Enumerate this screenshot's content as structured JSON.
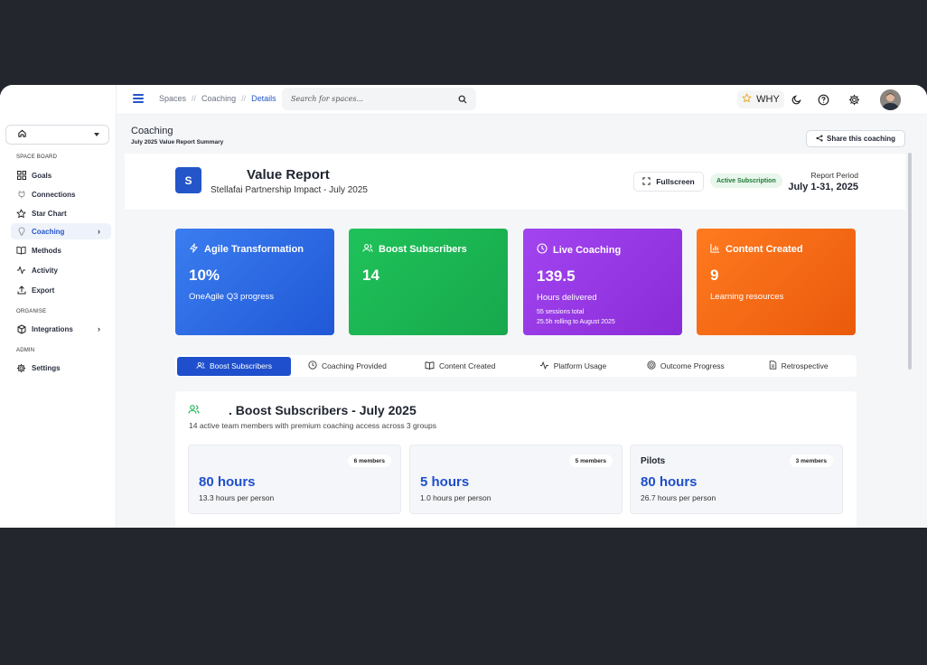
{
  "sidebar": {
    "sections": {
      "space_board": "SPACE BOARD",
      "organise": "ORGANISE",
      "admin": "ADMIN"
    },
    "items": [
      {
        "label": "Goals",
        "icon": "grid-icon"
      },
      {
        "label": "Connections",
        "icon": "plug-icon"
      },
      {
        "label": "Star Chart",
        "icon": "star-icon"
      },
      {
        "label": "Coaching",
        "icon": "lightbulb-icon"
      },
      {
        "label": "Methods",
        "icon": "book-icon"
      },
      {
        "label": "Activity",
        "icon": "activity-icon"
      },
      {
        "label": "Export",
        "icon": "upload-icon"
      },
      {
        "label": "Integrations",
        "icon": "box-icon"
      },
      {
        "label": "Settings",
        "icon": "gear-icon"
      }
    ]
  },
  "topbar": {
    "breadcrumbs": [
      "Spaces",
      "Coaching",
      "Details"
    ],
    "breadcrumb_sep": "//",
    "search_placeholder": "Search for spaces...",
    "why_label": "WHY"
  },
  "header": {
    "title": "Coaching",
    "subtitle": "July 2025 Value Report Summary",
    "share_label": "Share this coaching"
  },
  "report": {
    "logo_letter": "S",
    "title": "Value Report",
    "subtitle": "Stellafai Partnership Impact - July 2025",
    "fullscreen_label": "Fullscreen",
    "status_badge": "Active Subscription",
    "period_label": "Report Period",
    "period_value": "July 1-31, 2025"
  },
  "cards": [
    {
      "title": "Agile Transformation",
      "value": "10%",
      "desc": "OneAgile Q3 progress",
      "icon": "bolt-icon"
    },
    {
      "title": "Boost Subscribers",
      "value": "14",
      "desc": "",
      "icon": "users-icon"
    },
    {
      "title": "Live Coaching",
      "value": "139.5",
      "desc": "Hours delivered",
      "note1": "55 sessions total",
      "note2": "25.5h rolling to August 2025",
      "icon": "clock-icon"
    },
    {
      "title": "Content Created",
      "value": "9",
      "desc": "Learning resources",
      "icon": "bar-chart-icon"
    }
  ],
  "tabs": [
    {
      "label": "Boost Subscribers",
      "icon": "users-icon"
    },
    {
      "label": "Coaching Provided",
      "icon": "clock-icon"
    },
    {
      "label": "Content Created",
      "icon": "book-icon"
    },
    {
      "label": "Platform Usage",
      "icon": "activity-icon"
    },
    {
      "label": "Outcome Progress",
      "icon": "target-icon"
    },
    {
      "label": "Retrospective",
      "icon": "document-icon"
    }
  ],
  "panel": {
    "title": ". Boost Subscribers - July 2025",
    "subtitle": "14 active team members with premium coaching access across 3 groups",
    "groups": [
      {
        "name": "",
        "members": "6 members",
        "hours": "80 hours",
        "per": "13.3 hours per person"
      },
      {
        "name": "",
        "members": "5 members",
        "hours": "5 hours",
        "per": "1.0 hours per person"
      },
      {
        "name": "Pilots",
        "members": "3 members",
        "hours": "80 hours",
        "per": "26.7 hours per person"
      }
    ]
  },
  "colors": {
    "accent": "#2456c9",
    "blue": "#2f6ae6",
    "green": "#1bb654",
    "purple": "#9637e4",
    "orange": "#f36a15"
  }
}
